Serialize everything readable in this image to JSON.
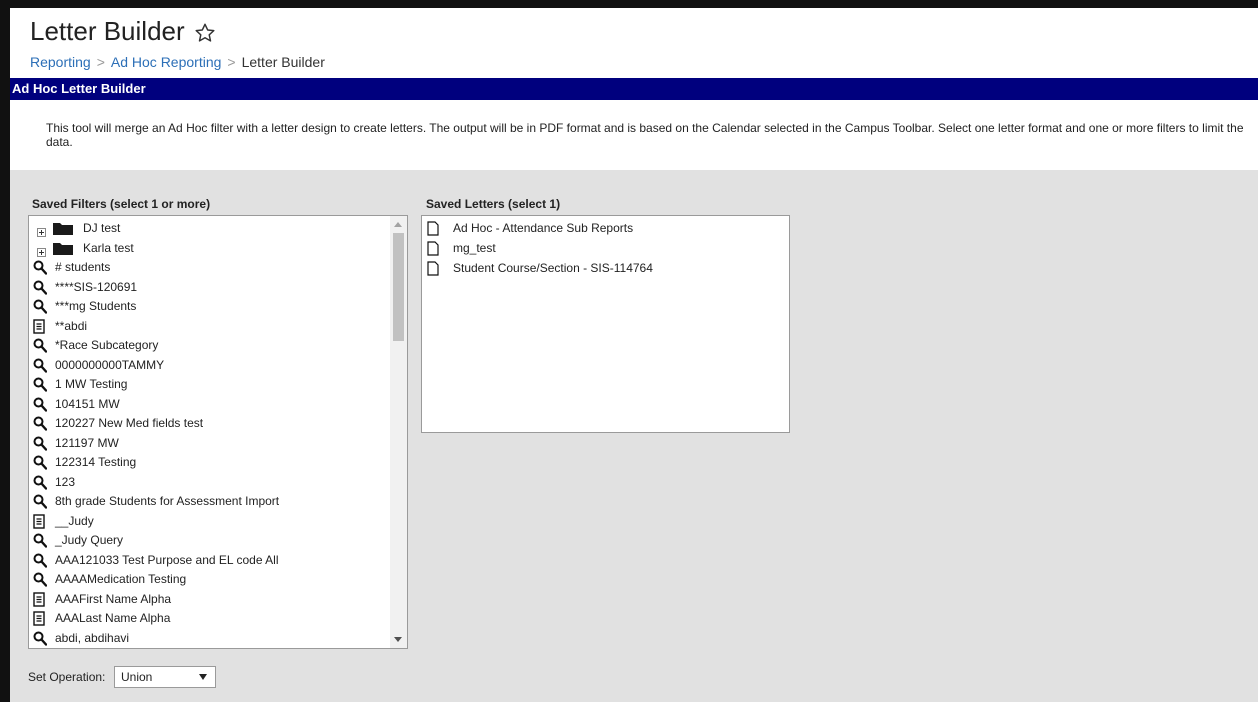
{
  "page": {
    "title": "Letter Builder",
    "breadcrumb": [
      "Reporting",
      "Ad Hoc Reporting",
      "Letter Builder"
    ]
  },
  "section_title": "Ad Hoc Letter Builder",
  "description": "This tool will merge an Ad Hoc filter with a letter design to create letters. The output will be in PDF format and is based on the Calendar selected in the Campus Toolbar. Select one letter format and one or more filters to limit the data.",
  "saved_filters": {
    "label": "Saved Filters (select 1 or more)",
    "items": [
      {
        "name": "DJ test",
        "icon": "folder-icon"
      },
      {
        "name": "Karla test",
        "icon": "folder-icon"
      },
      {
        "name": "# students",
        "icon": "magnifier-icon"
      },
      {
        "name": "****SIS-120691",
        "icon": "magnifier-icon"
      },
      {
        "name": "***mg Students",
        "icon": "magnifier-icon"
      },
      {
        "name": "**abdi",
        "icon": "document-icon"
      },
      {
        "name": "*Race Subcategory",
        "icon": "magnifier-icon"
      },
      {
        "name": "0000000000TAMMY",
        "icon": "magnifier-icon"
      },
      {
        "name": "1 MW Testing",
        "icon": "magnifier-icon"
      },
      {
        "name": "104151 MW",
        "icon": "magnifier-icon"
      },
      {
        "name": "120227 New Med fields test",
        "icon": "magnifier-icon"
      },
      {
        "name": "121197 MW",
        "icon": "magnifier-icon"
      },
      {
        "name": "122314 Testing",
        "icon": "magnifier-icon"
      },
      {
        "name": "123",
        "icon": "magnifier-icon"
      },
      {
        "name": "8th grade Students for Assessment Import",
        "icon": "magnifier-icon"
      },
      {
        "name": "__Judy",
        "icon": "document-icon"
      },
      {
        "name": "_Judy Query",
        "icon": "magnifier-icon"
      },
      {
        "name": "AAA121033 Test Purpose and EL code All",
        "icon": "magnifier-icon"
      },
      {
        "name": "AAAAMedication Testing",
        "icon": "magnifier-icon"
      },
      {
        "name": "AAAFirst Name Alpha",
        "icon": "document-icon"
      },
      {
        "name": "AAALast Name Alpha",
        "icon": "document-icon"
      },
      {
        "name": "abdi, abdihavi",
        "icon": "magnifier-icon"
      }
    ]
  },
  "saved_letters": {
    "label": "Saved Letters (select 1)",
    "items": [
      {
        "name": "Ad Hoc - Attendance Sub Reports",
        "icon": "page-icon"
      },
      {
        "name": "mg_test",
        "icon": "page-icon"
      },
      {
        "name": "Student Course/Section - SIS-114764",
        "icon": "page-icon"
      }
    ]
  },
  "set_operation": {
    "label": "Set Operation:",
    "value": "Union"
  },
  "colors": {
    "section_bar": "#00007e",
    "link": "#2c6fb7",
    "panel_bg": "#e1e1e1"
  }
}
